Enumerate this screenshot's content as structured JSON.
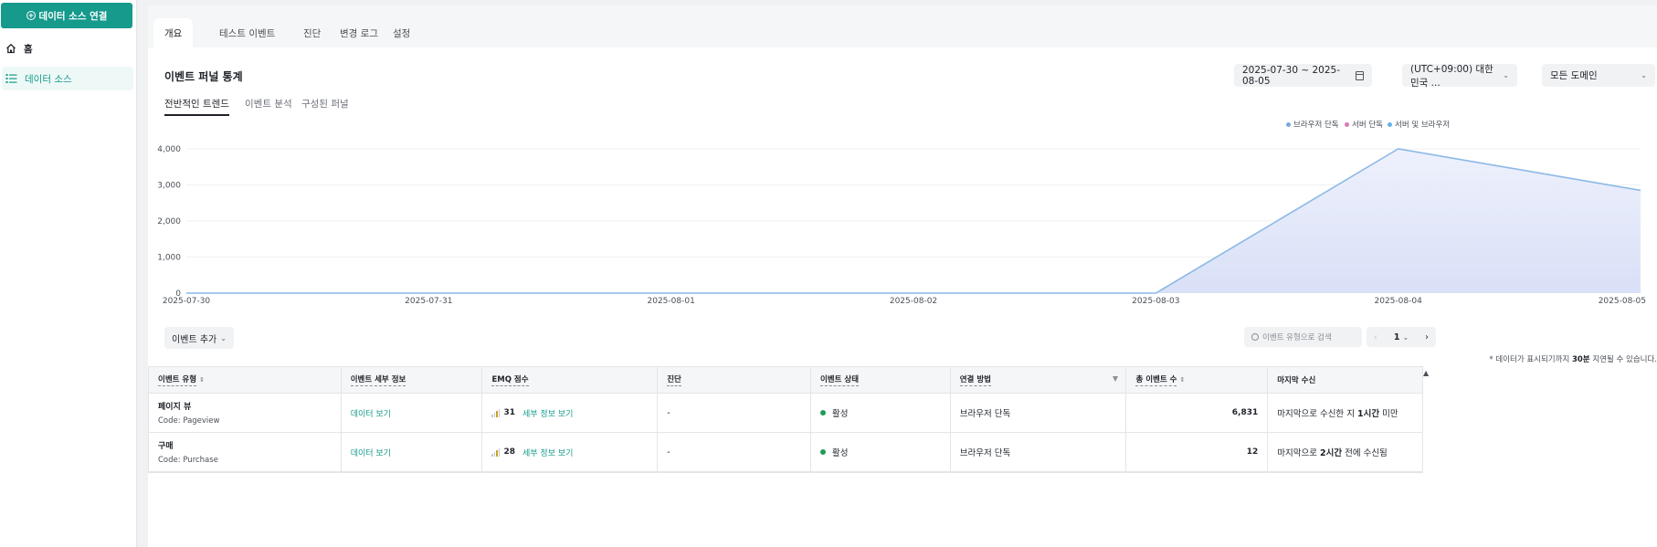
{
  "sidebar": {
    "connect_button": "데이터 소스 연결",
    "items": [
      {
        "label": "홈",
        "icon": "home-icon"
      },
      {
        "label": "데이터 소스",
        "icon": "list-icon"
      }
    ]
  },
  "tabs": [
    "개요",
    "테스트 이벤트",
    "진단",
    "변경 로그",
    "설정"
  ],
  "active_tab": "개요",
  "section_title": "이벤트 퍼널 통계",
  "date_range": "2025-07-30 ~ 2025-08-05",
  "timezone": "(UTC+09:00) 대한민국 ...",
  "domain_select": "모든 도메인",
  "subtabs": [
    "전반적인 트렌드",
    "이벤트 분석",
    "구성된 퍼널"
  ],
  "legend": [
    {
      "label": "브라우저 단독",
      "color": "#7aa7e0"
    },
    {
      "label": "서버 단독",
      "color": "#d97ab5"
    },
    {
      "label": "서버 및 브라우저",
      "color": "#67b3e8"
    }
  ],
  "chart_data": {
    "type": "area",
    "categories": [
      "2025-07-30",
      "2025-07-31",
      "2025-08-01",
      "2025-08-02",
      "2025-08-03",
      "2025-08-04",
      "2025-08-05"
    ],
    "series": [
      {
        "name": "브라우저 단독",
        "values": [
          0,
          0,
          0,
          0,
          0,
          4000,
          2850
        ]
      }
    ],
    "yticks": [
      "0",
      "1,000",
      "2,000",
      "3,000",
      "4,000"
    ],
    "ylim": [
      0,
      4000
    ],
    "grid": true,
    "legend_position": "top-right"
  },
  "toolbar": {
    "add_event": "이벤트 추가",
    "search_placeholder": "이벤트 유형으로 검색",
    "page": "1",
    "delay_note_prefix": "* 데이터가 표시되기까지 ",
    "delay_note_bold": "30분",
    "delay_note_suffix": " 지연될 수 있습니다."
  },
  "table": {
    "headers": [
      "이벤트 유형",
      "이벤트 세부 정보",
      "EMQ 점수",
      "진단",
      "이벤트 상태",
      "연결 방법",
      "총 이벤트 수",
      "마지막 수신"
    ],
    "rows": [
      {
        "name": "페이지 뷰",
        "code": "Code: Pageview",
        "details": "데이터 보기",
        "emq": "31",
        "emq_link": "세부 정보 보기",
        "diagnosis": "-",
        "status": "활성",
        "method": "브라우저 단독",
        "total": "6,831",
        "last_prefix": "마지막으로 수신한 지 ",
        "last_bold": "1시간",
        "last_suffix": " 미만"
      },
      {
        "name": "구매",
        "code": "Code: Purchase",
        "details": "데이터 보기",
        "emq": "28",
        "emq_link": "세부 정보 보기",
        "diagnosis": "-",
        "status": "활성",
        "method": "브라우저 단독",
        "total": "12",
        "last_prefix": "마지막으로 ",
        "last_bold": "2시간",
        "last_suffix": " 전에 수신됨"
      }
    ]
  }
}
